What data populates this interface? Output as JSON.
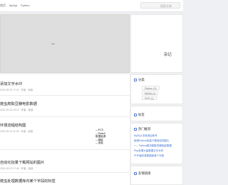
{
  "nav": {
    "items": [
      "首页",
      "MySql",
      "Python"
    ]
  },
  "search": {
    "placeholder": "搜索文章"
  },
  "hero": {
    "placeholder_mark": "—"
  },
  "posts": [
    {
      "title": "添加文字水印",
      "meta": "2021-09-22 17:11 · 作者 · 阅读"
    },
    {
      "title": "爬虫爬取豆瓣电影数据",
      "meta": "2021-09-22 14:12 · 作者 · 阅读"
    },
    {
      "title": "环境流程结构图",
      "meta": "2021-09-22 11:04 · 作者 · 阅读"
    },
    {
      "title": "自动化批量下载网站的图片",
      "meta": "2021-09-21 17:06 · 作者 · 阅读"
    },
    {
      "title": "爬虫处理数据库内某个字段的标签",
      "meta": ""
    }
  ],
  "tree_lines": [
    "—PCS",
    "—Switch",
    "数据能源",
    "—储能",
    "—多能"
  ],
  "sidebar": {
    "notes_title": "杂记",
    "category_title": "分类",
    "categories": [
      "Python (3)",
      "MySql (1)",
      "PHP (1)"
    ],
    "tags_title": "标签",
    "hot_title": "热门推荐",
    "hot_links": [
      "MySQL字段添加序号",
      "使用Python批量下载网站的图片",
      "一、Python爬虫爬取豆瓣电影数据",
      "Php处理大量数据文字水印",
      "PHP遍历某数据库某个字段"
    ],
    "links_title": "友情链接"
  },
  "colors": {
    "accent": "#3b6fcf",
    "page_bg": "#eef0f3"
  }
}
